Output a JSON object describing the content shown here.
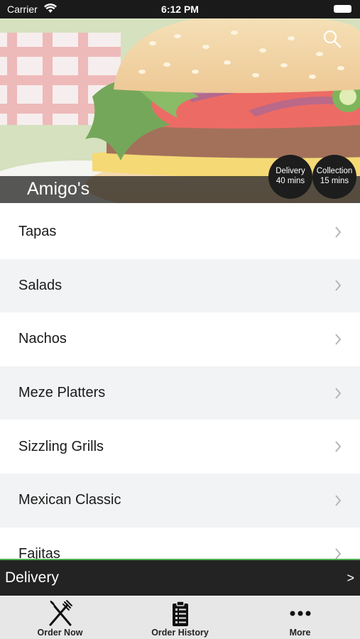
{
  "status_bar": {
    "carrier": "Carrier",
    "time": "6:12 PM"
  },
  "hero": {
    "restaurant_name": "Amigo's",
    "delivery_badge": {
      "line1": "Delivery",
      "line2": "40 mins"
    },
    "collection_badge": {
      "line1": "Collection",
      "line2": "15 mins"
    }
  },
  "menu": {
    "categories": [
      {
        "label": "Tapas"
      },
      {
        "label": "Salads"
      },
      {
        "label": "Nachos"
      },
      {
        "label": "Meze Platters"
      },
      {
        "label": "Sizzling Grills"
      },
      {
        "label": "Mexican Classic"
      },
      {
        "label": "Fajitas"
      }
    ]
  },
  "order_mode_bar": {
    "label": "Delivery",
    "arrow": ">"
  },
  "tabbar": {
    "tabs": [
      {
        "label": "Order Now",
        "icon": "fork-knife-icon"
      },
      {
        "label": "Order History",
        "icon": "clipboard-list-icon"
      },
      {
        "label": "More",
        "icon": "ellipsis-icon"
      }
    ]
  },
  "colors": {
    "accent": "#4caf50",
    "bar": "#232323",
    "tabbar": "#e7e7e7",
    "row_alt": "#f2f3f5"
  }
}
